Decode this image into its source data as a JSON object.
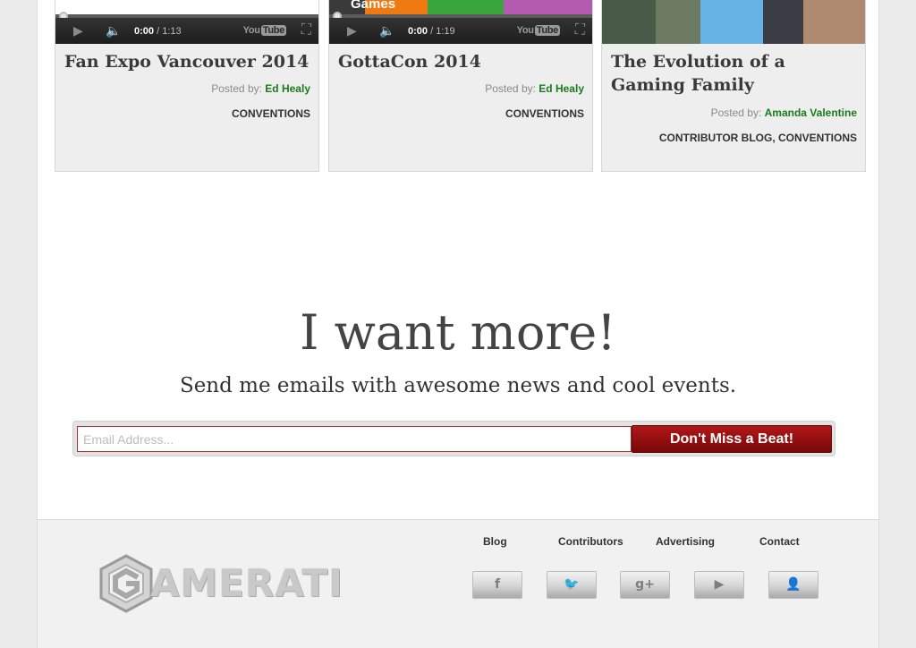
{
  "cards": [
    {
      "title": "Fan Expo Vancouver 2014",
      "posted_by_label": "Posted by:",
      "author": "Ed Healy",
      "categories": "CONVENTIONS",
      "video_time": "0:00",
      "video_duration": "/ 1:13",
      "thumb_text": ""
    },
    {
      "title": "GottaCon 2014",
      "posted_by_label": "Posted by:",
      "author": "Ed Healy",
      "categories": "CONVENTIONS",
      "video_time": "0:00",
      "video_duration": "/ 1:19",
      "thumb_text": "Games"
    },
    {
      "title": "The Evolution of a Gaming Family",
      "posted_by_label": "Posted by:",
      "author": "Amanda Valentine",
      "categories": "CONTRIBUTOR BLOG, CONVENTIONS"
    }
  ],
  "video_player": {
    "brand_prefix": "You",
    "brand_suffix": "Tube"
  },
  "signup": {
    "headline": "I want more!",
    "subline": "Send me emails with awesome news and cool events.",
    "email_placeholder": "Email Address...",
    "button_label": "Don't Miss a Beat!"
  },
  "footer": {
    "logo_text": "AMERATI",
    "links": [
      "Blog",
      "Contributors",
      "Advertising",
      "Contact"
    ],
    "social": [
      {
        "icon": "facebook-icon",
        "glyph": "f"
      },
      {
        "icon": "twitter-icon",
        "glyph": "🐦"
      },
      {
        "icon": "google-plus-icon",
        "glyph": "g+"
      },
      {
        "icon": "youtube-icon",
        "glyph": "▶"
      },
      {
        "icon": "profile-icon",
        "glyph": "👤"
      }
    ]
  },
  "colors": {
    "author_green": "#1c7a1c",
    "cta_red": "#a01010",
    "input_border_red": "#b03030"
  }
}
